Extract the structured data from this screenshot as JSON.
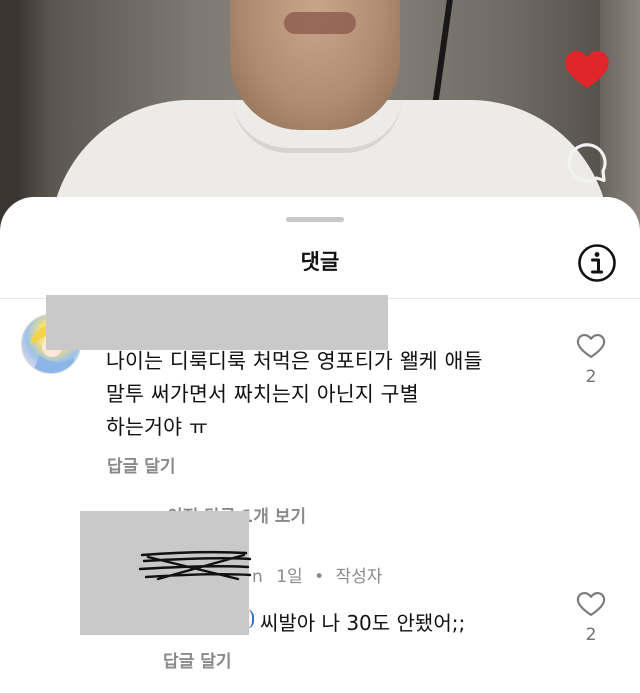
{
  "sheet": {
    "title": "댓글"
  },
  "video": {
    "heart_color": "#e0262a"
  },
  "comments": [
    {
      "text_lines": [
        "나이는 디룩디룩 처먹은 영포티가 왤케 애들",
        "말투 써가면서 짜치는지 아닌지 구별",
        "하는거야 ㅠ"
      ],
      "reply_label": "답글 달기",
      "likes": "2",
      "view_replies_label": "이전 답글 1개 보기"
    }
  ],
  "reply": {
    "username_fragment": "n",
    "time": "1일",
    "separator": "•",
    "author_badge": "작성자",
    "text": "씨발아 나 30도 안됐어;;",
    "reply_label": "답글 달기",
    "likes": "2"
  }
}
